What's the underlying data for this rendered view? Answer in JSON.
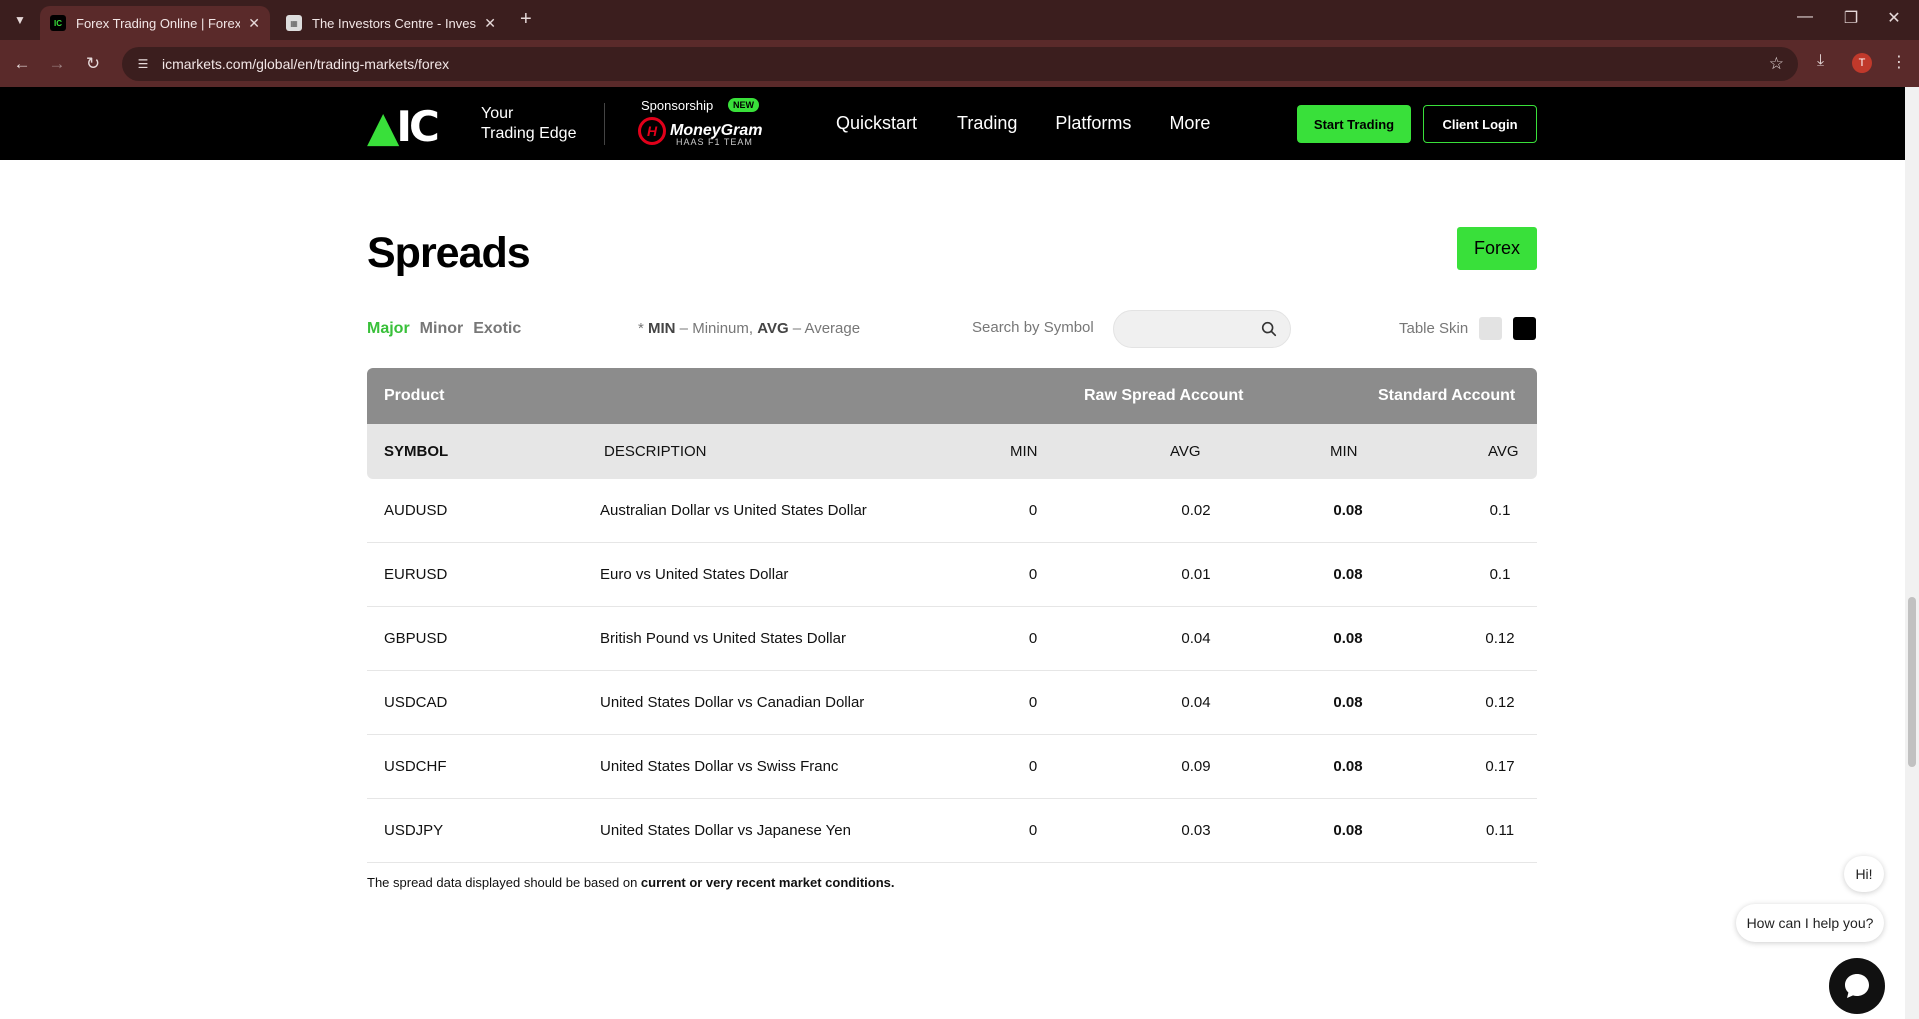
{
  "browser": {
    "tabs": [
      {
        "title": "Forex Trading Online | Forex CF",
        "favicon": "ic",
        "active": true
      },
      {
        "title": "The Investors Centre - Investing",
        "favicon": "ti",
        "active": false
      }
    ],
    "url": "icmarkets.com/global/en/trading-markets/forex",
    "profile_initial": "T"
  },
  "header": {
    "logo_text": "IC",
    "tagline_line1": "Your",
    "tagline_line2": "Trading Edge",
    "sponsorship_label": "Sponsorship",
    "new_badge": "NEW",
    "sponsor_name": "MoneyGram",
    "sponsor_sub": "HAAS F1 TEAM",
    "nav": [
      "Quickstart",
      "Trading",
      "Platforms",
      "More"
    ],
    "start_trading": "Start Trading",
    "client_login": "Client Login"
  },
  "page": {
    "title": "Spreads",
    "market_button": "Forex",
    "filters": [
      "Major",
      "Minor",
      "Exotic"
    ],
    "active_filter": "Major",
    "legend": {
      "prefix": "* ",
      "min_key": "MIN",
      "min_text": " – Mininum, ",
      "avg_key": "AVG",
      "avg_text": " – Average"
    },
    "search_label": "Search by Symbol",
    "search_value": "",
    "table_skin_label": "Table Skin",
    "disclaimer_text": "The spread data displayed should be based on ",
    "disclaimer_bold": "current or very recent market conditions."
  },
  "table": {
    "group_headers": {
      "product": "Product",
      "raw": "Raw Spread Account",
      "standard": "Standard Account"
    },
    "columns": {
      "symbol": "SYMBOL",
      "description": "DESCRIPTION",
      "raw_min": "MIN",
      "raw_avg": "AVG",
      "std_min": "MIN",
      "std_avg": "AVG"
    },
    "rows": [
      {
        "symbol": "AUDUSD",
        "description": "Australian Dollar vs United States Dollar",
        "raw_min": "0",
        "raw_avg": "0.02",
        "std_min": "0.08",
        "std_avg": "0.1"
      },
      {
        "symbol": "EURUSD",
        "description": "Euro vs United States Dollar",
        "raw_min": "0",
        "raw_avg": "0.01",
        "std_min": "0.08",
        "std_avg": "0.1"
      },
      {
        "symbol": "GBPUSD",
        "description": "British Pound vs United States Dollar",
        "raw_min": "0",
        "raw_avg": "0.04",
        "std_min": "0.08",
        "std_avg": "0.12"
      },
      {
        "symbol": "USDCAD",
        "description": "United States Dollar vs Canadian Dollar",
        "raw_min": "0",
        "raw_avg": "0.04",
        "std_min": "0.08",
        "std_avg": "0.12"
      },
      {
        "symbol": "USDCHF",
        "description": "United States Dollar vs Swiss Franc",
        "raw_min": "0",
        "raw_avg": "0.09",
        "std_min": "0.08",
        "std_avg": "0.17"
      },
      {
        "symbol": "USDJPY",
        "description": "United States Dollar vs Japanese Yen",
        "raw_min": "0",
        "raw_avg": "0.03",
        "std_min": "0.08",
        "std_avg": "0.11"
      }
    ]
  },
  "chat": {
    "greeting": "Hi!",
    "prompt": "How can I help you?"
  },
  "colors": {
    "accent": "#39e03a",
    "header_bg": "#000000",
    "table_head": "#8c8c8c",
    "browser_frame": "#5a2a2a"
  }
}
